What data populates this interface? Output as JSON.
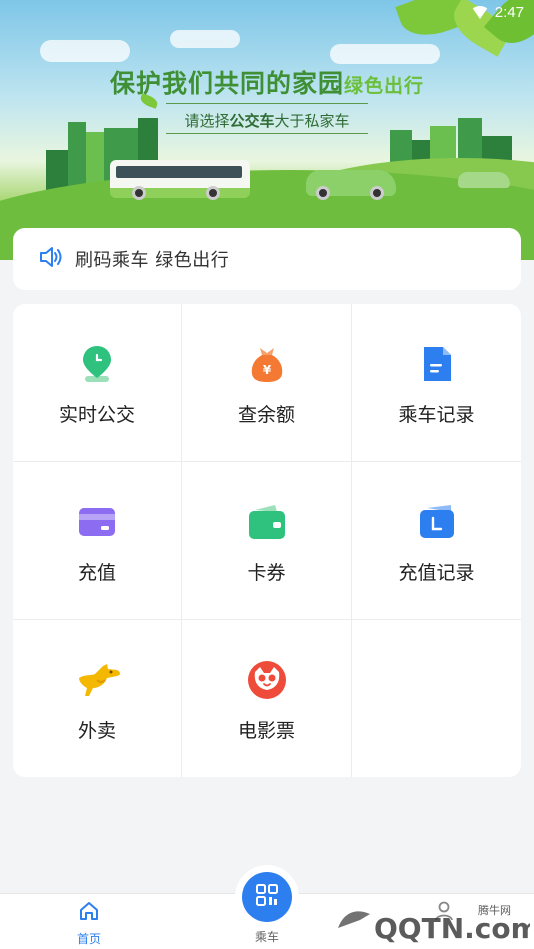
{
  "status_bar": {
    "time": "2:47"
  },
  "banner": {
    "title_main": "保护我们共同的家园",
    "title_accent": "绿色出行",
    "subtitle_pre": "请选择",
    "subtitle_bold": "公交车",
    "subtitle_post": "大于私家车"
  },
  "notice": {
    "text": "刷码乘车 绿色出行",
    "icon": "speaker-icon"
  },
  "services": [
    {
      "label": "实时公交",
      "icon": "bus-location-icon",
      "color": "#2ec27e"
    },
    {
      "label": "查余额",
      "icon": "money-bag-icon",
      "color": "#f47a33"
    },
    {
      "label": "乘车记录",
      "icon": "document-icon",
      "color": "#2d7ff0"
    },
    {
      "label": "充值",
      "icon": "card-icon",
      "color": "#8c6cf0"
    },
    {
      "label": "卡券",
      "icon": "wallet-icon",
      "color": "#2ec27e"
    },
    {
      "label": "充值记录",
      "icon": "recharge-record-icon",
      "color": "#2d7ff0"
    },
    {
      "label": "外卖",
      "icon": "kangaroo-icon",
      "color": "#f5b800"
    },
    {
      "label": "电影票",
      "icon": "cat-icon",
      "color": "#ee4b3a"
    }
  ],
  "nav": {
    "home_label": "首页",
    "ride_label": "乘车",
    "accent": "#2d7ff0"
  },
  "watermark": {
    "text": "QQTN.com",
    "sub": "腾牛网"
  }
}
